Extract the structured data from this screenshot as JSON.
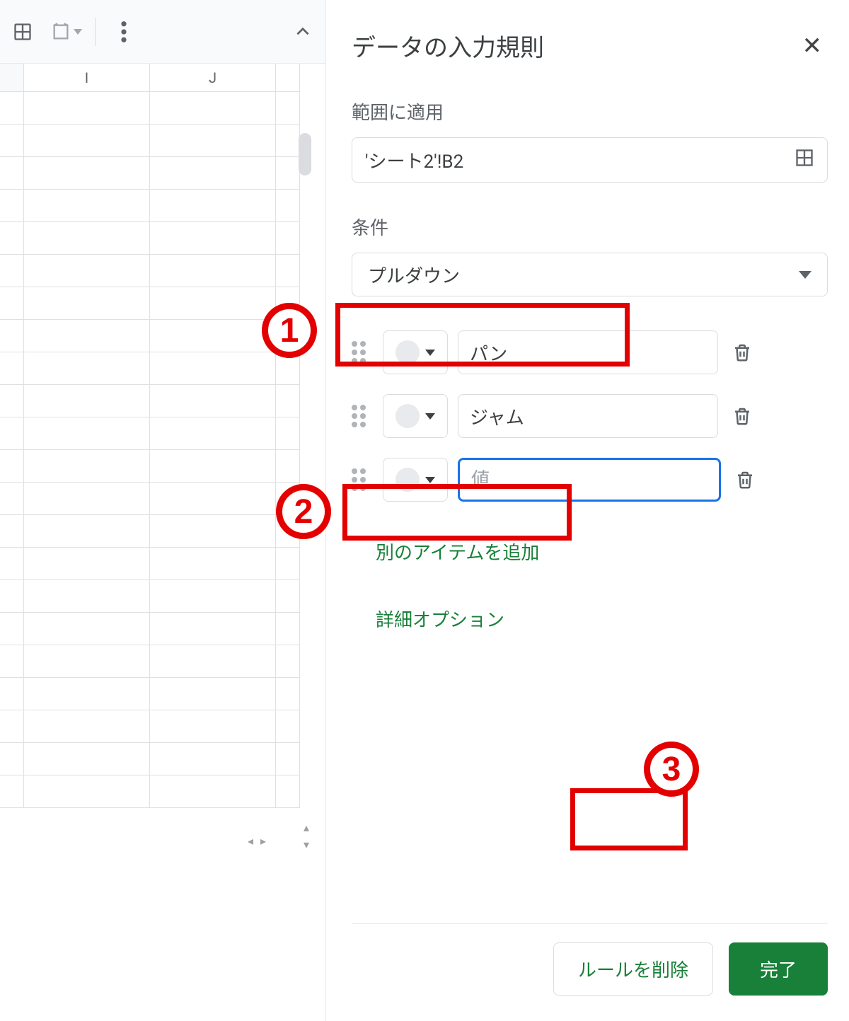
{
  "toolbar": {},
  "sheet": {
    "columns": [
      "I",
      "J"
    ]
  },
  "panel": {
    "title": "データの入力規則",
    "range_label": "範囲に適用",
    "range_value": "'シート2'!B2",
    "condition_label": "条件",
    "condition_value": "プルダウン",
    "items": [
      {
        "value": "パン"
      },
      {
        "value": "ジャム"
      },
      {
        "value": "",
        "placeholder": "値",
        "focused": true
      }
    ],
    "add_item_label": "別のアイテムを追加",
    "advanced_label": "詳細オプション",
    "delete_rule_label": "ルールを削除",
    "done_label": "完了"
  },
  "annotations": {
    "1": "1",
    "2": "2",
    "3": "3"
  }
}
